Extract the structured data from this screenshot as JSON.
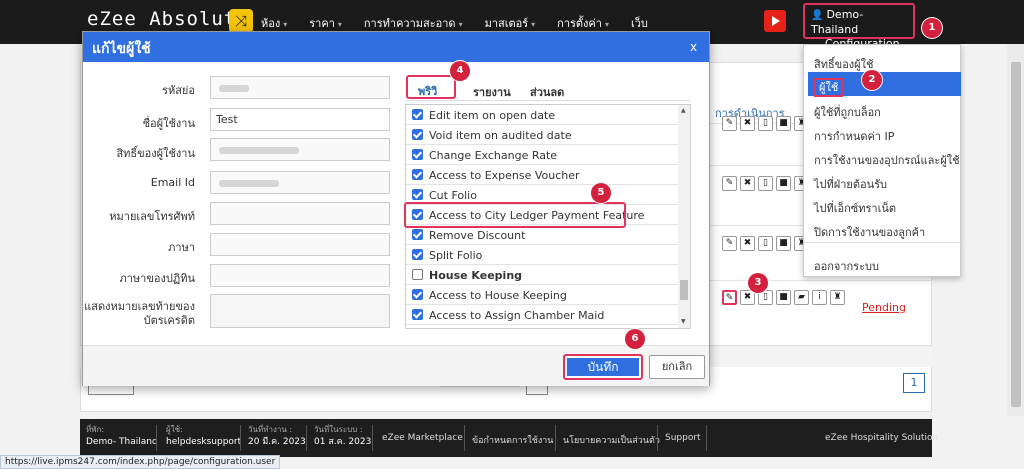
{
  "nav": {
    "brand": "eZee Absolute",
    "menu": [
      "ห้อง",
      "ราคา",
      "การทำความสะอาด",
      "มาสเตอร์",
      "การตั้งค่า",
      "เว็บ"
    ],
    "user_line1": "Demo- Thailand",
    "user_line2": "Configuration"
  },
  "dropdown": {
    "items": [
      "สิทธิ์ของผู้ใช้",
      "ผู้ใช้",
      "ผู้ใช้ที่ถูกบล็อก",
      "การกำหนดค่า IP",
      "การใช้งานของอุปกรณ์และผู้ใช้",
      "ไปที่ฝ่ายต้อนรับ",
      "ไปที่เอ็กซ์ทราเน็ต",
      "ปิดการใช้งานของลูกค้า"
    ],
    "logout": "ออกจากระบบ"
  },
  "modal": {
    "title": "แก้ไขผู้ใช้",
    "close": "x",
    "labels": [
      "รหัสย่อ",
      "ชื่อผู้ใช้งาน",
      "สิทธิ์ของผู้ใช้งาน",
      "Email Id",
      "หมายเลขโทรศัพท์",
      "ภาษา",
      "ภาษาของปฏิทิน",
      "แสดงหมายเลขท้ายของ",
      "บัตรเครดิต"
    ],
    "username_value": "Test",
    "tabs": [
      "พริวิเลจ",
      "รายงาน",
      "ส่วนลด"
    ],
    "privileges": [
      {
        "label": "Edit item on open date",
        "checked": true,
        "group": false
      },
      {
        "label": "Void item on audited date",
        "checked": true,
        "group": false
      },
      {
        "label": "Change Exchange Rate",
        "checked": true,
        "group": false
      },
      {
        "label": "Access to Expense Voucher",
        "checked": true,
        "group": false
      },
      {
        "label": "Cut Folio",
        "checked": true,
        "group": false
      },
      {
        "label": "Access to City Ledger Payment Feature",
        "checked": true,
        "group": false
      },
      {
        "label": "Remove Discount",
        "checked": true,
        "group": false
      },
      {
        "label": "Split Folio",
        "checked": true,
        "group": false
      },
      {
        "label": "House Keeping",
        "checked": false,
        "group": true
      },
      {
        "label": "Access to House Keeping",
        "checked": true,
        "group": false
      },
      {
        "label": "Access to Assign Chamber Maid",
        "checked": true,
        "group": false
      }
    ],
    "save": "บันทึก",
    "cancel": "ยกเลิก"
  },
  "background": {
    "actions_header": "การดำเนินการ",
    "pending": "Pending",
    "page": "1"
  },
  "badges": [
    "1",
    "2",
    "3",
    "4",
    "5",
    "6"
  ],
  "footer": {
    "property_k": "ที่พัก:",
    "property_v": "Demo- Thailand",
    "user_k": "ผู้ใช้:",
    "user_v": "helpdesksupport",
    "workdate_k": "วันที่ทำงาน :",
    "workdate_v": "20 มี.ค. 2023",
    "sysdate_k": "วันที่ในระบบ :",
    "sysdate_v": "01 ส.ค. 2023",
    "links": [
      "eZee Marketplace",
      "ข้อกำหนดการใช้งาน",
      "นโยบายความเป็นส่วนตัว",
      "Support"
    ],
    "brand": "eZee Hospitality Solution"
  },
  "status_url": "https://live.ipms247.com/index.php/page/configuration.user",
  "colors": {
    "nav_bg": "#1b1b1b",
    "primary": "#2f6fe0",
    "highlight": "#e0335e",
    "badge": "#d3203c"
  }
}
